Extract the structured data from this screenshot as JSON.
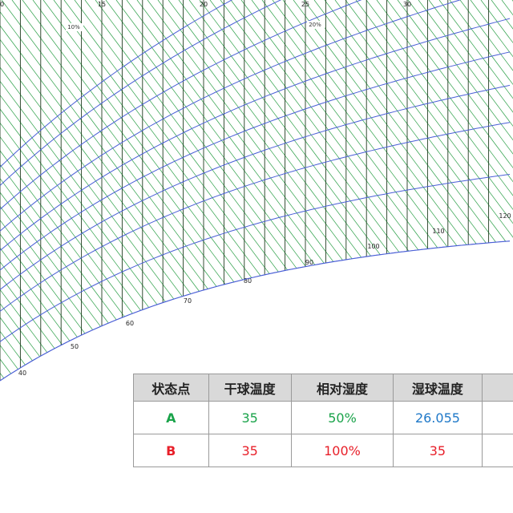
{
  "chart_data": {
    "type": "line",
    "title": "",
    "xlabel": "",
    "ylabel": "",
    "x_ticks": [
      10,
      15,
      20,
      25,
      30
    ],
    "xlim": [
      10,
      34
    ],
    "rh_lines": [
      {
        "label": "10%",
        "rh": 10
      },
      {
        "label": "20%",
        "rh": 20
      },
      {
        "label": "",
        "rh": 30
      },
      {
        "label": "",
        "rh": 40
      },
      {
        "label": "",
        "rh": 50
      },
      {
        "label": "",
        "rh": 60
      },
      {
        "label": "",
        "rh": 70
      },
      {
        "label": "",
        "rh": 80
      },
      {
        "label": "",
        "rh": 90
      },
      {
        "label": "",
        "rh": 100
      }
    ],
    "enthalpy_labels": [
      40,
      50,
      60,
      70,
      80,
      90,
      100,
      110,
      120
    ],
    "grid": true,
    "colors": {
      "rh_curve": "#4a5fd6",
      "hatch": "#2ca048",
      "vertical": "#1e3a1e"
    }
  },
  "table": {
    "headers": [
      "状态点",
      "干球温度",
      "相对湿度",
      "湿球温度",
      ""
    ],
    "rows": [
      {
        "point": "A",
        "dry": "35",
        "rh": "50%",
        "wet": "26.055",
        "point_color": "#1aa34a",
        "dry_color": "#1aa34a",
        "rh_color": "#1aa34a",
        "wet_color": "#1e78c8"
      },
      {
        "point": "B",
        "dry": "35",
        "rh": "100%",
        "wet": "35",
        "point_color": "#e8202a",
        "dry_color": "#e8202a",
        "rh_color": "#e8202a",
        "wet_color": "#e8202a"
      }
    ]
  }
}
